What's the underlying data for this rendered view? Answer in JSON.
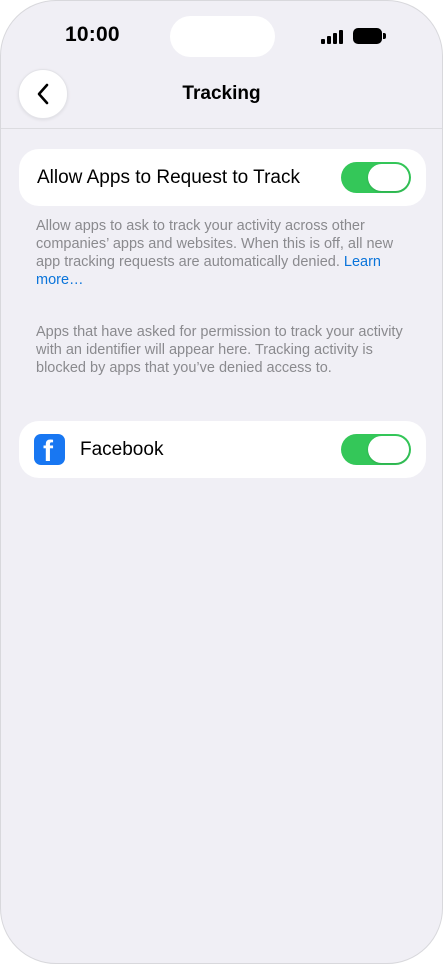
{
  "status_bar": {
    "time": "10:00",
    "icons": [
      "cellular-signal-icon",
      "battery-icon"
    ]
  },
  "nav": {
    "back_icon": "chevron-left-icon",
    "title": "Tracking"
  },
  "allow_tracking": {
    "label": "Allow Apps to Request to Track",
    "enabled": true,
    "description_text": "Allow apps to ask to track your activity across other companies’ apps and websites. When this is off, all new app tracking requests are automatically denied. ",
    "learn_more": "Learn more…"
  },
  "apps_section": {
    "description": "Apps that have asked for permission to track your activity with an identifier will appear here. Tracking activity is blocked by apps that you’ve denied access to.",
    "apps": [
      {
        "name": "Facebook",
        "icon": "facebook-icon",
        "enabled": true
      }
    ]
  },
  "colors": {
    "background": "#f0eff5",
    "toggle_on": "#34c759",
    "link": "#0a74da",
    "facebook_brand": "#1877f2"
  }
}
